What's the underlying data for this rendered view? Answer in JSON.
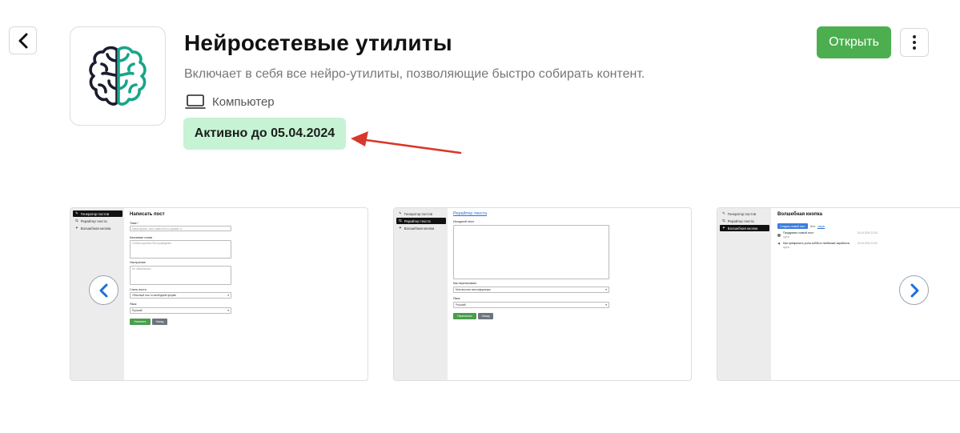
{
  "app": {
    "title": "Нейросетевые утилиты",
    "description": "Включает в себя все нейро-утилиты, позволяющие быстро собирать контент.",
    "platform": "Компьютер",
    "active_badge": "Активно до 05.04.2024",
    "icon": "brain-icon"
  },
  "header": {
    "back_icon": "chevron-left-icon",
    "open_label": "Открыть",
    "more_icon": "vertical-dots-icon"
  },
  "colors": {
    "open_button": "#4cae4f",
    "badge_background": "#c6f3d4",
    "arrow": "#d9372b",
    "brain_dark": "#1b1c2e",
    "brain_teal": "#17a589"
  },
  "gallery": {
    "prev_icon": "chevron-left-icon",
    "next_icon": "chevron-right-icon",
    "screenshots": [
      {
        "nav": [
          "Генератор постов",
          "Рерайтер текста",
          "Волшебная кнопка"
        ],
        "active": 0,
        "heading": "Написать пост",
        "topic_label": "Тема *",
        "topic_placeholder": "Какая фраза, опыт заменить из-руками то",
        "keywords_label": "Ключевые слова",
        "keywords_placeholder": "Собрать данные без проведения",
        "mood_label": "Настроение",
        "mood_placeholder": "Не обязательно",
        "style_label": "Стиль поста",
        "style_value": "Обычный пост в свободной форме",
        "lang_label": "Язык",
        "lang_value": "Русский",
        "write_button": "Написать",
        "back_button": "Назад"
      },
      {
        "nav": [
          "Генератор постов",
          "Рерайтер текста",
          "Волшебная кнопка"
        ],
        "active": 1,
        "heading": "Рерайтер текста",
        "source_label": "Исходный текст",
        "how_label": "Как перетасовать",
        "how_value": "Мне вполне неконформную",
        "lang_label": "Язык",
        "lang_value": "Русский",
        "rewrite_button": "Переписать",
        "back_button": "Назад"
      },
      {
        "nav": [
          "Генератор постов",
          "Рерайтер текста",
          "Волшебная кнопка"
        ],
        "active": 2,
        "heading": "Волшебная кнопка",
        "create_button": "Создать новый пост",
        "or_text": "Или:",
        "link_text": "новую",
        "item1_title": "Придумать новый пост",
        "item1_sub": "ждём",
        "item1_date": "01.04.2024 12:34",
        "item2_title": "Как превратить роли хобби в любимый заработок",
        "item2_sub": "ждём",
        "item2_date": "01.04.2024 12:34"
      }
    ]
  }
}
